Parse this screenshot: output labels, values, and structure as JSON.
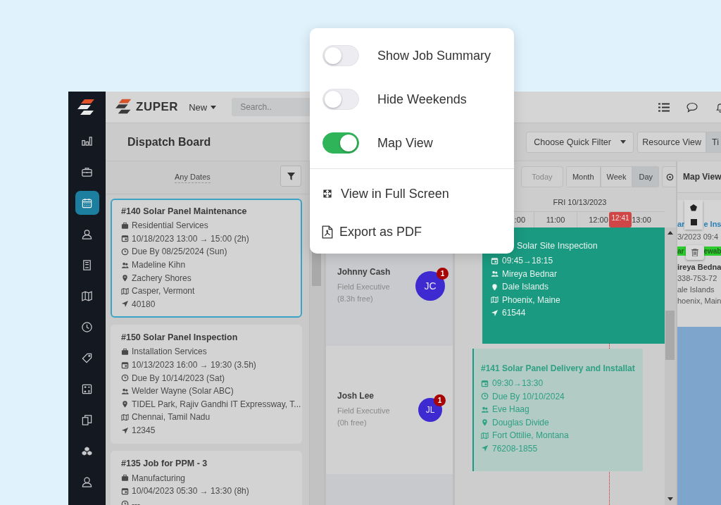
{
  "popup_menu": {
    "toggles": [
      {
        "label": "Show Job Summary",
        "on": false
      },
      {
        "label": "Hide Weekends",
        "on": false
      },
      {
        "label": "Map View",
        "on": true
      }
    ],
    "actions": [
      {
        "kind": "fullscreen",
        "label": "View in Full Screen"
      },
      {
        "kind": "pdf",
        "label": "Export as PDF"
      }
    ]
  },
  "sidebar": {
    "items": [
      {
        "kind": "chart",
        "selected": false
      },
      {
        "kind": "briefcase",
        "selected": false
      },
      {
        "kind": "calendar",
        "selected": true
      },
      {
        "kind": "contacts",
        "selected": false
      },
      {
        "kind": "building",
        "selected": false
      },
      {
        "kind": "map",
        "selected": false
      },
      {
        "kind": "clock",
        "selected": false
      },
      {
        "kind": "tag",
        "selected": false
      },
      {
        "kind": "calculator",
        "selected": false
      },
      {
        "kind": "copies",
        "selected": false
      },
      {
        "kind": "boxes",
        "selected": false
      },
      {
        "kind": "user",
        "selected": false
      }
    ]
  },
  "top_bar": {
    "logo": "ZUPER",
    "new_menu": "New",
    "search_placeholder": "Search.."
  },
  "header": {
    "title": "Dispatch Board",
    "quick_filter": "Choose Quick Filter",
    "views": [
      {
        "label": "Resource View",
        "selected": false
      },
      {
        "label": "Ti",
        "selected": true
      }
    ]
  },
  "job_list": {
    "date_filter": "Any Dates",
    "jobs": [
      {
        "title": "#140 Solar Panel Maintenance",
        "selected": true,
        "lines": [
          {
            "kind": "category",
            "text": "Residential Services"
          },
          {
            "kind": "schedule",
            "text": "10/18/2023 13:00 → 15:00 (2h)"
          },
          {
            "kind": "due",
            "text": "Due By 08/25/2024 (Sun)"
          },
          {
            "kind": "team",
            "text": "Madeline Kihn"
          },
          {
            "kind": "address",
            "text": "Zachery Shores"
          },
          {
            "kind": "city",
            "text": "Casper, Vermont"
          },
          {
            "kind": "zip",
            "text": "40180"
          }
        ]
      },
      {
        "title": "#150 Solar Panel Inspection",
        "selected": false,
        "lines": [
          {
            "kind": "category",
            "text": "Installation Services"
          },
          {
            "kind": "schedule",
            "text": "10/13/2023 16:00 → 19:30 (3.5h)"
          },
          {
            "kind": "due",
            "text": "Due By 10/14/2023 (Sat)"
          },
          {
            "kind": "team",
            "text": "Welder Wayne (Solar ABC)"
          },
          {
            "kind": "address",
            "text": "TIDEL Park, Rajiv Gandhi IT Expressway, T..."
          },
          {
            "kind": "city",
            "text": "Chennai, Tamil Nadu"
          },
          {
            "kind": "zip",
            "text": "12345"
          }
        ]
      },
      {
        "title": "#135 Job for PPM - 3",
        "selected": false,
        "lines": [
          {
            "kind": "category",
            "text": "Manufacturing"
          },
          {
            "kind": "schedule",
            "text": "10/04/2023 05:30 → 13:30 (8h)"
          },
          {
            "kind": "due",
            "text": "---"
          }
        ]
      }
    ]
  },
  "calendar": {
    "today": "Today",
    "ranges": [
      {
        "label": "Month",
        "selected": false
      },
      {
        "label": "Week",
        "selected": false
      },
      {
        "label": "Day",
        "selected": true
      }
    ],
    "date": "FRI 10/13/2023",
    "hours": [
      ":00",
      "11:00",
      "12:00",
      "13:00"
    ],
    "now": "12:41",
    "resources": [
      {
        "name": "Johnny Cash",
        "role": "Field Executive",
        "free": "(8.3h free)",
        "initials": "JC",
        "badge": "1",
        "job": {
          "kind": "solid",
          "title": "Solar Site Inspection",
          "lines": [
            {
              "kind": "schedule",
              "text": "09:45→18:15"
            },
            {
              "kind": "team",
              "text": "Mireya Bednar"
            },
            {
              "kind": "address",
              "text": "Dale Islands"
            },
            {
              "kind": "city",
              "text": "Phoenix, Maine"
            },
            {
              "kind": "zip",
              "text": "61544"
            }
          ]
        }
      },
      {
        "name": "Josh Lee",
        "role": "Field Executive",
        "free": "(0h free)",
        "initials": "JL",
        "badge": "1",
        "job": {
          "kind": "light",
          "title": "#141 Solar Panel Delivery and Installat",
          "lines": [
            {
              "kind": "schedule",
              "text": "09:30→13:30"
            },
            {
              "kind": "due",
              "text": "Due By 10/10/2024"
            },
            {
              "kind": "team",
              "text": "Eve Haag"
            },
            {
              "kind": "address",
              "text": "Douglas Divide"
            },
            {
              "kind": "city",
              "text": "Fort Ottilie, Montana"
            },
            {
              "kind": "zip",
              "text": "76208-1855"
            }
          ]
        }
      }
    ]
  },
  "map": {
    "title": "Map View",
    "card": {
      "title_fragments": [
        "ar",
        "e Ins"
      ],
      "date": "3/2023 09:4",
      "tag_fragments": [
        "ar",
        "ewab"
      ],
      "lines": [
        "ireya Bedna",
        "338-753-72",
        "ale Islands",
        "hoenix, Main"
      ]
    }
  }
}
